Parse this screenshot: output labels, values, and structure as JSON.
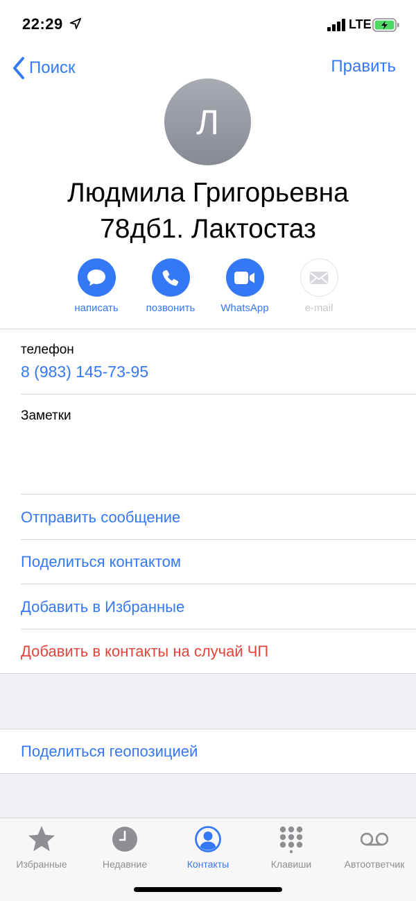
{
  "status_bar": {
    "time": "22:29",
    "network": "LTE",
    "icons": [
      "location-arrow-icon",
      "signal-bars-icon",
      "battery-charging-icon"
    ]
  },
  "nav": {
    "back_label": "Поиск",
    "edit_label": "Править"
  },
  "contact": {
    "initial": "Л",
    "name_line1": "Людмила Григорьевна",
    "name_line2": "78дб1. Лактостаз"
  },
  "actions": [
    {
      "label": "написать",
      "icon": "message-bubble-icon",
      "enabled": true
    },
    {
      "label": "позвонить",
      "icon": "phone-icon",
      "enabled": true
    },
    {
      "label": "WhatsApp",
      "icon": "video-camera-icon",
      "enabled": true
    },
    {
      "label": "e-mail",
      "icon": "envelope-icon",
      "enabled": false
    }
  ],
  "phone": {
    "label": "телефон",
    "value": "8 (983) 145-73-95"
  },
  "notes": {
    "label": "Заметки"
  },
  "links": {
    "send_message": "Отправить сообщение",
    "share_contact": "Поделиться контактом",
    "add_favorites": "Добавить в Избранные",
    "add_emergency": "Добавить в контакты на случай ЧП",
    "share_location": "Поделиться геопозицией"
  },
  "tabs": [
    {
      "label": "Избранные",
      "icon": "star-icon",
      "active": false
    },
    {
      "label": "Недавние",
      "icon": "clock-icon",
      "active": false
    },
    {
      "label": "Контакты",
      "icon": "person-circle-icon",
      "active": true
    },
    {
      "label": "Клавиши",
      "icon": "keypad-icon",
      "active": false
    },
    {
      "label": "Автоответчик",
      "icon": "voicemail-icon",
      "active": false
    }
  ],
  "colors": {
    "accent": "#3478f6",
    "danger": "#e5443a",
    "inactive": "#8e8e93",
    "group_background": "#efeff4"
  }
}
